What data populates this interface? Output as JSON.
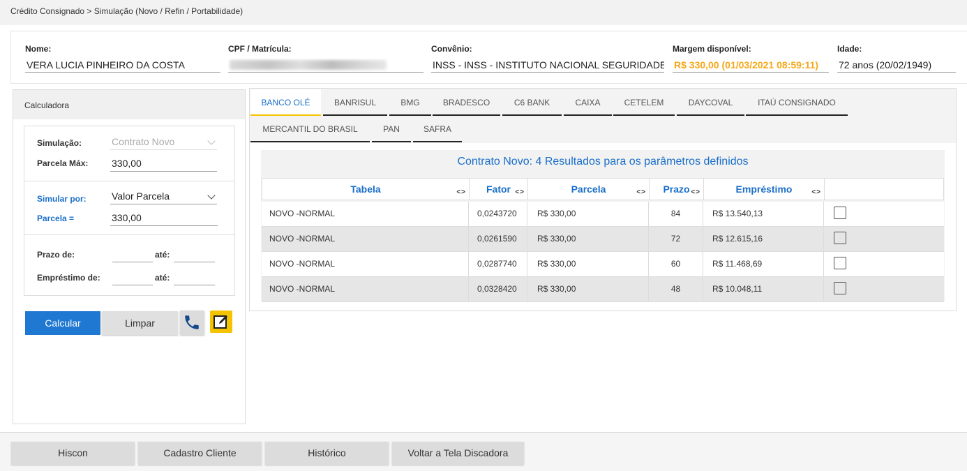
{
  "breadcrumb": "Crédito Consignado > Simulação (Novo / Refin / Portabilidade)",
  "client": {
    "nome_label": "Nome:",
    "nome": "VERA LUCIA PINHEIRO DA COSTA",
    "cpf_label": "CPF / Matrícula:",
    "convenio_label": "Convênio:",
    "convenio": "INSS - INSS - INSTITUTO NACIONAL SEGURIDADE",
    "margem_label": "Margem disponível:",
    "margem": "R$ 330,00 (01/03/2021 08:59:11)",
    "idade_label": "Idade:",
    "idade": "72 anos (20/02/1949)"
  },
  "calculator": {
    "title": "Calculadora",
    "simulacao_label": "Simulação:",
    "simulacao_value": "Contrato Novo",
    "parcela_max_label": "Parcela Máx:",
    "parcela_max_value": "330,00",
    "simular_por_label": "Simular por:",
    "simular_por_value": "Valor Parcela",
    "parcela_eq_label": "Parcela =",
    "parcela_eq_value": "330,00",
    "prazo_de_label": "Prazo de:",
    "ate_label": "até:",
    "emprestimo_de_label": "Empréstimo de:",
    "calcular_label": "Calcular",
    "limpar_label": "Limpar"
  },
  "tabs": [
    "BANCO OLÉ",
    "BANRISUL",
    "BMG",
    "BRADESCO",
    "C6 BANK",
    "CAIXA",
    "CETELEM",
    "DAYCOVAL",
    "ITAÚ CONSIGNADO",
    "MERCANTIL DO BRASIL",
    "PAN",
    "SAFRA"
  ],
  "results": {
    "title": "Contrato Novo: 4 Resultados para os parâmetros definidos",
    "sort_glyph": "<>",
    "columns": [
      "Tabela",
      "Fator",
      "Parcela",
      "Prazo",
      "Empréstimo"
    ],
    "rows": [
      {
        "tabela": "NOVO -NORMAL",
        "fator": "0,0243720",
        "parcela": "R$ 330,00",
        "prazo": "84",
        "emprestimo": "R$ 13.540,13"
      },
      {
        "tabela": "NOVO -NORMAL",
        "fator": "0,0261590",
        "parcela": "R$ 330,00",
        "prazo": "72",
        "emprestimo": "R$ 12.615,16"
      },
      {
        "tabela": "NOVO -NORMAL",
        "fator": "0,0287740",
        "parcela": "R$ 330,00",
        "prazo": "60",
        "emprestimo": "R$ 11.468,69"
      },
      {
        "tabela": "NOVO -NORMAL",
        "fator": "0,0328420",
        "parcela": "R$ 330,00",
        "prazo": "48",
        "emprestimo": "R$ 10.048,11"
      }
    ]
  },
  "footer": {
    "hiscon": "Hiscon",
    "cadastro": "Cadastro Cliente",
    "historico": "Histórico",
    "voltar": "Voltar a Tela Discadora"
  },
  "icons": {
    "phone": "phone-icon",
    "edit": "edit-icon",
    "chevron": "chevron-down-icon",
    "checkbox": "checkbox"
  },
  "colors": {
    "primary": "#1f78d1",
    "accent": "#f5c400",
    "margin_text": "#f5a81a",
    "header_text": "#1a6fc9"
  }
}
